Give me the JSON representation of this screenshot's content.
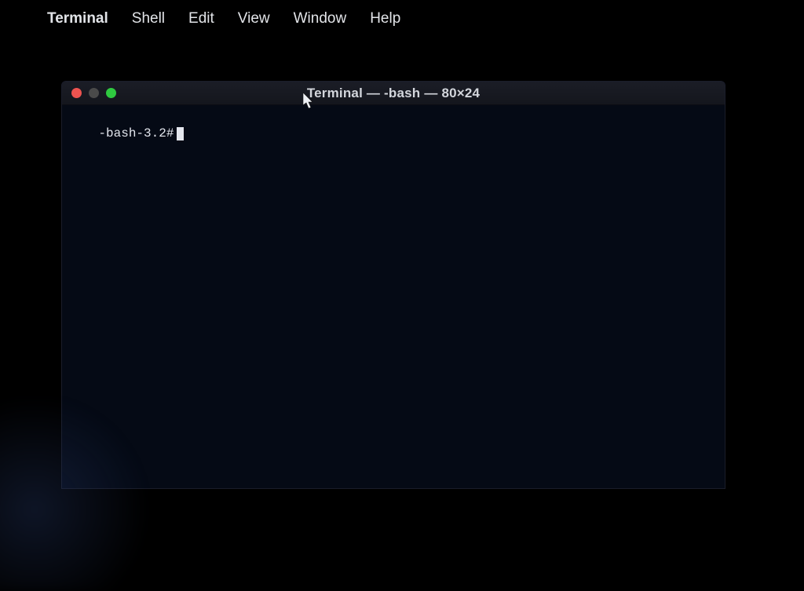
{
  "menubar": {
    "apple": "",
    "app_name": "Terminal",
    "items": [
      "Shell",
      "Edit",
      "View",
      "Window",
      "Help"
    ]
  },
  "window": {
    "title": "Terminal — -bash — 80×24",
    "traffic": {
      "close": "close",
      "minimize": "minimize",
      "maximize": "maximize"
    }
  },
  "terminal": {
    "prompt": "-bash-3.2#"
  }
}
